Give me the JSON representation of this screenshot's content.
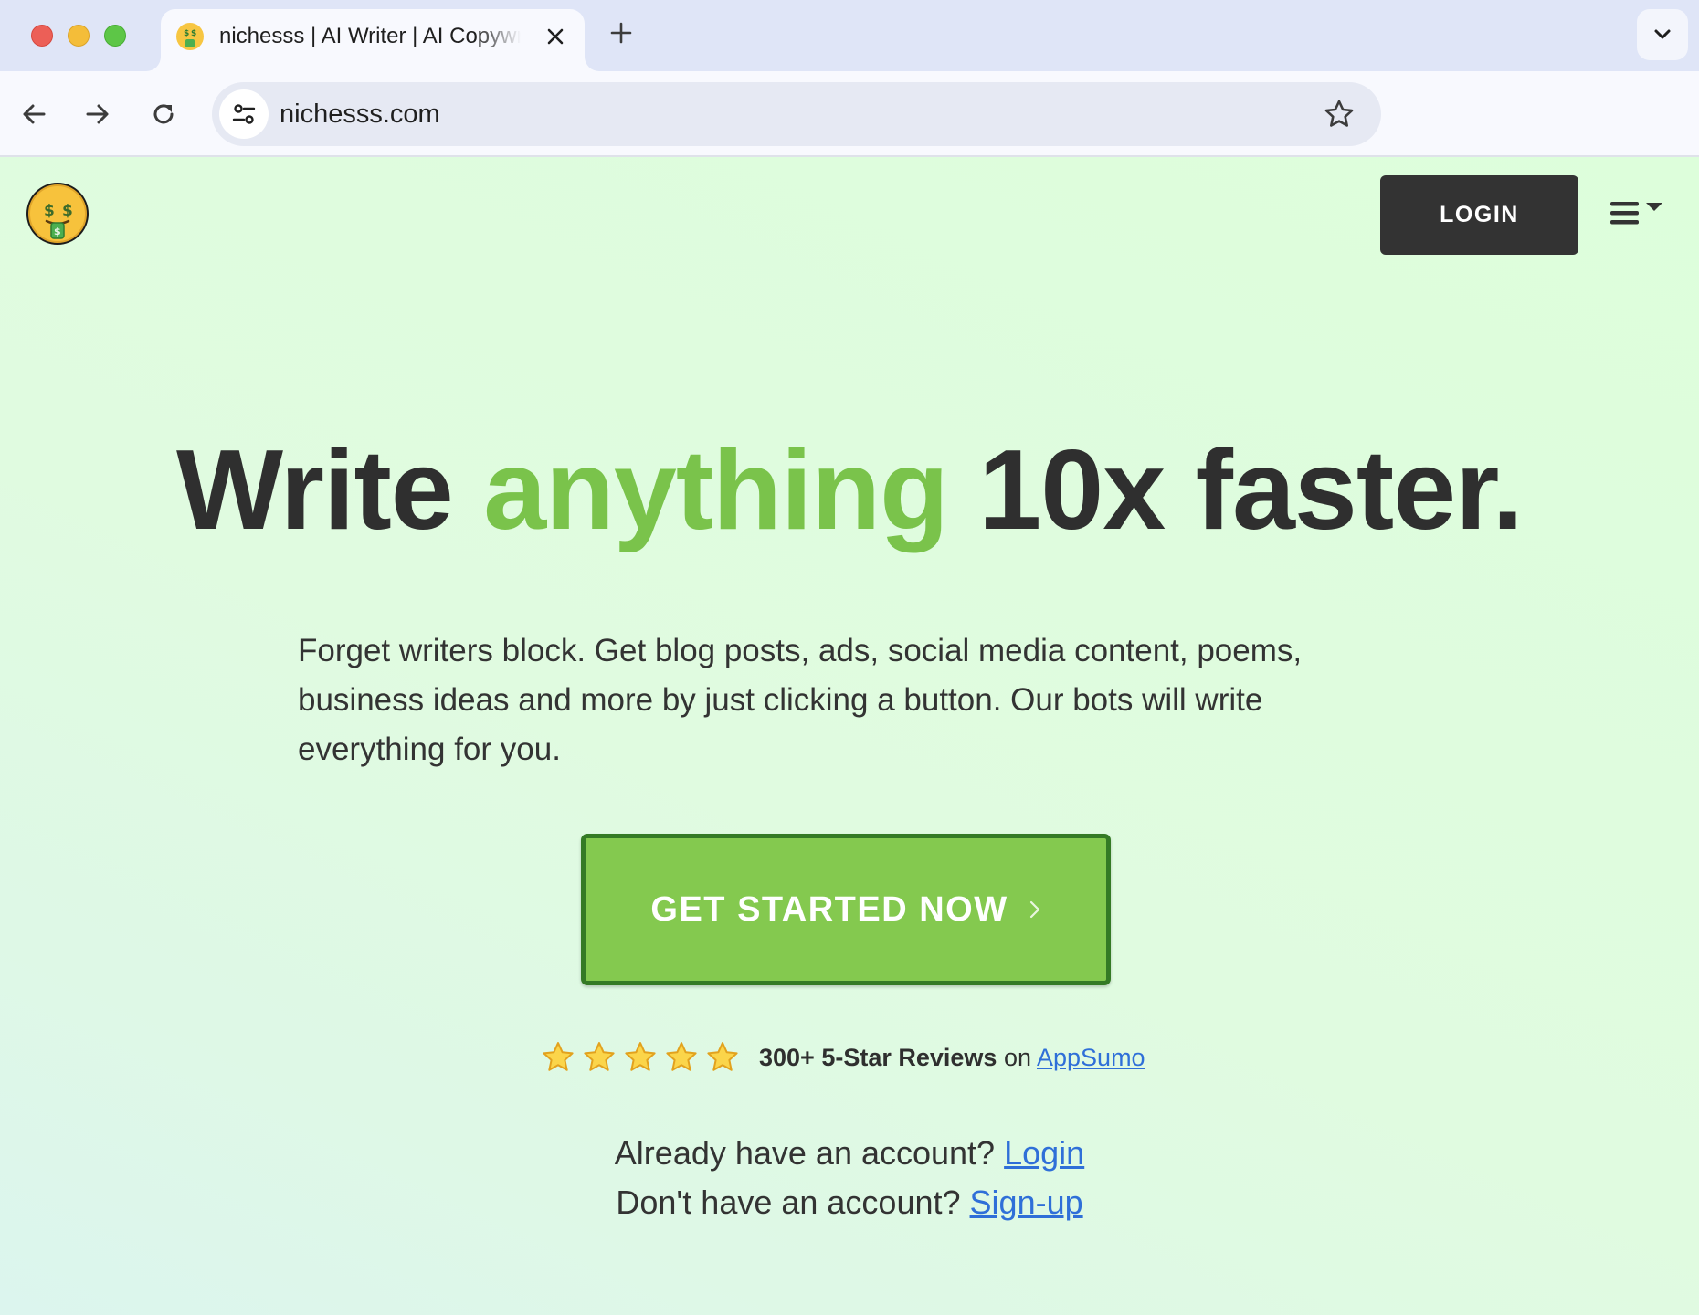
{
  "browser": {
    "tab_title": "nichesss | AI Writer | AI Copywriter",
    "url": "nichesss.com",
    "favicon": "money-mouth-face-icon"
  },
  "header": {
    "login_label": "LOGIN",
    "menu_icon": "hamburger-menu-icon"
  },
  "hero": {
    "headline_pre": "Write ",
    "headline_accent": "anything",
    "headline_post": " 10x faster.",
    "subtext": "Forget writers block. Get blog posts, ads, social media content, poems, business ideas and more by just clicking a button. Our bots will write everything for you.",
    "cta_label": "GET STARTED NOW"
  },
  "reviews": {
    "stars": 5,
    "bold_text": "300+ 5-Star Reviews",
    "on_text": "on",
    "link_text": "AppSumo"
  },
  "account": {
    "have_text": "Already have an account?",
    "login_link": "Login",
    "no_account_text": "Don't have an account?",
    "signup_link": "Sign-up"
  },
  "colors": {
    "accent_green": "#7ac34b",
    "cta_green": "#84c94f",
    "cta_border": "#347a25",
    "dark": "#333333",
    "link_blue": "#2f6fd8"
  }
}
